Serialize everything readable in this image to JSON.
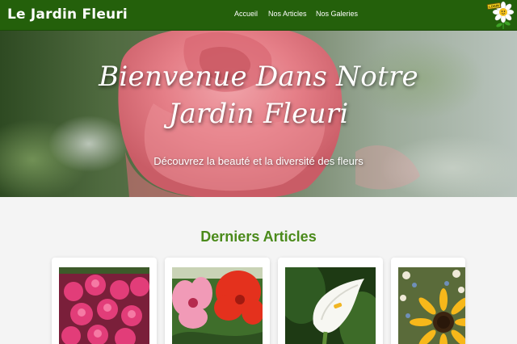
{
  "header": {
    "brand": "Le Jardin Fleuri",
    "nav": [
      {
        "label": "Accueil"
      },
      {
        "label": "Nos Articles"
      },
      {
        "label": "Nos Galeries"
      }
    ],
    "login_sign": "LOGIN"
  },
  "hero": {
    "title_line1": "Bienvenue Dans Notre",
    "title_line2": "Jardin Fleuri",
    "subtitle": "Découvrez la beauté et la diversité des fleurs"
  },
  "articles": {
    "title": "Derniers Articles",
    "cards": [
      {
        "image": "pink-azaleas"
      },
      {
        "image": "pink-and-red-hibiscus"
      },
      {
        "image": "white-calla-lily"
      },
      {
        "image": "sunflowers-bouquet"
      }
    ]
  },
  "colors": {
    "navbar": "#24600b",
    "section_title": "#4a8a1a",
    "page_background": "#f4f4f4"
  }
}
